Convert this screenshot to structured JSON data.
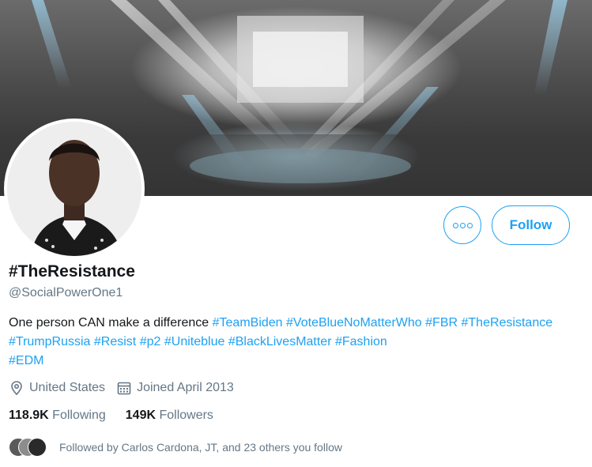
{
  "banner": {
    "description_icon": "concert-stage-banner"
  },
  "profile": {
    "display_name": "#TheResistance",
    "handle": "@SocialPowerOne1",
    "bio_text": "One person CAN make a difference",
    "hashtags": [
      "#TeamBiden",
      "#VoteBlueNoMatterWho",
      "#FBR",
      "#TheResistance",
      "#TrumpRussia",
      "#Resist",
      "#p2",
      "#Uniteblue",
      "#BlackLivesMatter",
      "#Fashion",
      "#EDM"
    ],
    "location": "United States",
    "joined": "Joined April 2013",
    "following_count": "118.9K",
    "following_label": "Following",
    "followers_count": "149K",
    "followers_label": "Followers",
    "followed_by": "Followed by Carlos Cardona, JT, and 23 others you follow"
  },
  "actions": {
    "follow_label": "Follow",
    "more_icon": "more-options-icon"
  },
  "colors": {
    "accent": "#1da1f2",
    "secondary_text": "#657786",
    "primary_text": "#14171a"
  }
}
